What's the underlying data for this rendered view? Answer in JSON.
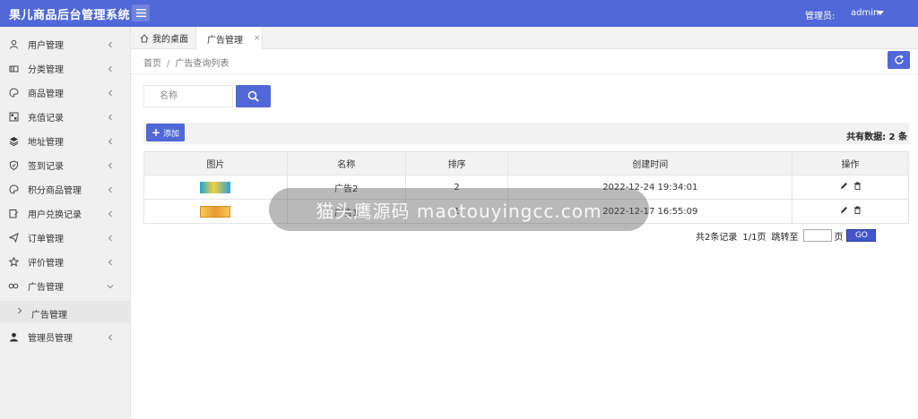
{
  "app": {
    "title": "果儿商品后台管理系统"
  },
  "header": {
    "admin_label": "管理员:",
    "admin_name": "admin"
  },
  "sidebar": {
    "items": [
      {
        "label": "用户管理",
        "icon": "user-icon"
      },
      {
        "label": "分类管理",
        "icon": "category-icon"
      },
      {
        "label": "商品管理",
        "icon": "palette-icon"
      },
      {
        "label": "充值记录",
        "icon": "grid-icon"
      },
      {
        "label": "地址管理",
        "icon": "layers-icon"
      },
      {
        "label": "签到记录",
        "icon": "shield-icon"
      },
      {
        "label": "积分商品管理",
        "icon": "palette-icon"
      },
      {
        "label": "用户兑换记录",
        "icon": "edit-icon"
      },
      {
        "label": "订单管理",
        "icon": "send-icon"
      },
      {
        "label": "评价管理",
        "icon": "star-icon"
      },
      {
        "label": "广告管理",
        "icon": "link-icon"
      },
      {
        "label": "管理员管理",
        "icon": "person-icon"
      }
    ],
    "sub_item": {
      "label": "广告管理"
    }
  },
  "tabs": {
    "home": "我的桌面",
    "active": "广告管理",
    "close": "×"
  },
  "breadcrumb": {
    "home": "首页",
    "sep": "/",
    "current": "广告查询列表"
  },
  "search": {
    "placeholder": "名称"
  },
  "toolbar": {
    "add_label": "添加",
    "total_text": "共有数据: 2 条"
  },
  "table": {
    "headers": [
      "图片",
      "名称",
      "排序",
      "创建时间",
      "操作"
    ],
    "rows": [
      {
        "name": "广告2",
        "sort": "2",
        "created": "2022-12-24 19:34:01"
      },
      {
        "name": "广告1",
        "sort": "1",
        "created": "2022-12-17 16:55:09"
      }
    ]
  },
  "pager": {
    "records": "共2条记录",
    "pages": "1/1页",
    "jump_label": "跳转至",
    "page_unit": "页",
    "go": "GO"
  },
  "overlay": {
    "watermark": "猫头鹰源码 maotouyingcc.com"
  },
  "colors": {
    "primary": "#5068d8",
    "sidebar_bg": "#f0f0f0"
  }
}
